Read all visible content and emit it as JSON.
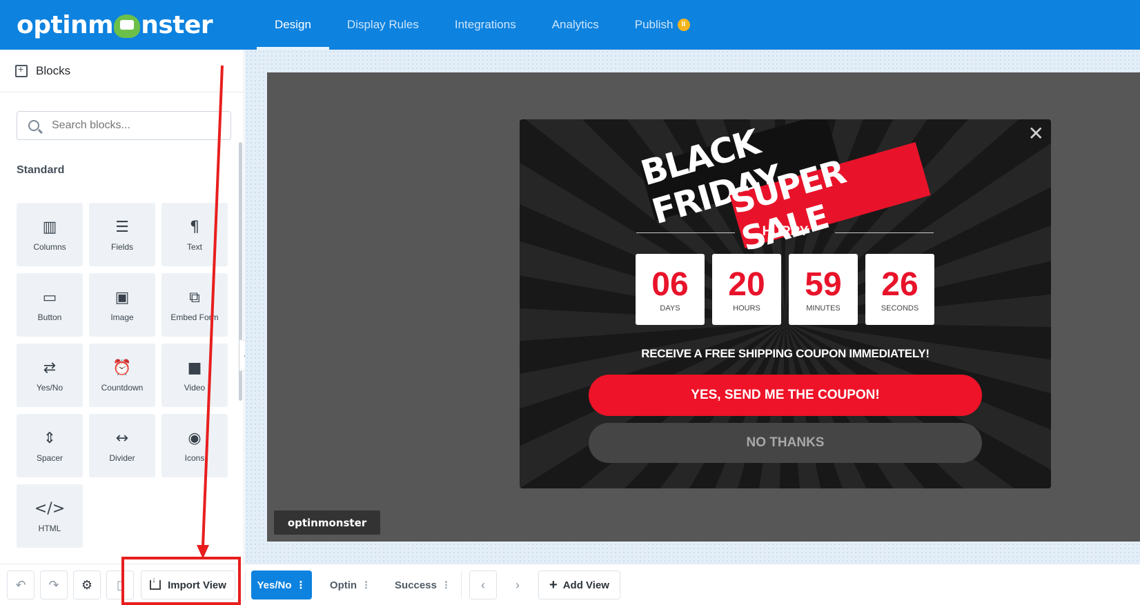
{
  "app": {
    "logo_text_left": "optinm",
    "logo_text_right": "nster"
  },
  "nav": {
    "items": [
      {
        "label": "Design"
      },
      {
        "label": "Display Rules"
      },
      {
        "label": "Integrations"
      },
      {
        "label": "Analytics"
      },
      {
        "label": "Publish"
      }
    ],
    "publish_badge": "II"
  },
  "sidebar": {
    "title": "Blocks",
    "search_placeholder": "Search blocks...",
    "section_label": "Standard",
    "blocks": [
      {
        "label": "Columns",
        "icon": "columns-icon",
        "glyph": "▥"
      },
      {
        "label": "Fields",
        "icon": "fields-icon",
        "glyph": "☰"
      },
      {
        "label": "Text",
        "icon": "paragraph-icon",
        "glyph": "¶"
      },
      {
        "label": "Button",
        "icon": "button-icon",
        "glyph": "▭"
      },
      {
        "label": "Image",
        "icon": "image-icon",
        "glyph": "▣"
      },
      {
        "label": "Embed Form",
        "icon": "embed-form-icon",
        "glyph": "⧉"
      },
      {
        "label": "Yes/No",
        "icon": "yes-no-icon",
        "glyph": "⇄"
      },
      {
        "label": "Countdown",
        "icon": "clock-icon",
        "glyph": "⏰"
      },
      {
        "label": "Video",
        "icon": "video-icon",
        "glyph": "■"
      },
      {
        "label": "Spacer",
        "icon": "spacer-icon",
        "glyph": "⇕"
      },
      {
        "label": "Divider",
        "icon": "divider-icon",
        "glyph": "↔"
      },
      {
        "label": "Icons",
        "icon": "heart-icon",
        "glyph": "◉"
      },
      {
        "label": "HTML",
        "icon": "code-icon",
        "glyph": "</>"
      }
    ]
  },
  "popup": {
    "banner_line1": "BLACK FRIDAY",
    "banner_line2": "SUPER SALE",
    "hurry": "HURRY",
    "countdown": [
      {
        "value": "06",
        "unit": "DAYS"
      },
      {
        "value": "20",
        "unit": "HOURS"
      },
      {
        "value": "59",
        "unit": "MINUTES"
      },
      {
        "value": "26",
        "unit": "SECONDS"
      }
    ],
    "offer_text": "RECEIVE A FREE SHIPPING COUPON IMMEDIATELY!",
    "yes_button": "YES, SEND ME THE COUPON!",
    "no_button": "NO THANKS",
    "close_glyph": "✕"
  },
  "powered_badge": "optinmonster",
  "bottombar": {
    "import_view": "Import View",
    "views": [
      {
        "label": "Yes/No",
        "active": true
      },
      {
        "label": "Optin",
        "active": false
      },
      {
        "label": "Success",
        "active": false
      }
    ],
    "add_view": "Add View"
  },
  "colors": {
    "brand_blue": "#0d82df",
    "accent_red": "#e8132a",
    "annotation_red": "#e81e1e"
  }
}
